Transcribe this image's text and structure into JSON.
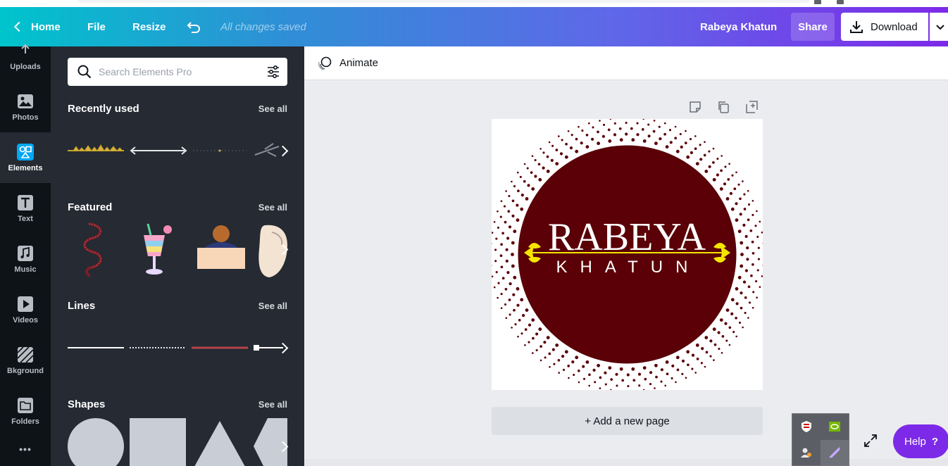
{
  "topbar": {
    "home": "Home",
    "file": "File",
    "resize": "Resize",
    "saved_status": "All changes saved",
    "user_name": "Rabeya Khatun",
    "share": "Share",
    "download": "Download"
  },
  "rail": {
    "uploads": "Uploads",
    "photos": "Photos",
    "elements": "Elements",
    "text": "Text",
    "music": "Music",
    "videos": "Videos",
    "background": "Bkground",
    "folders": "Folders",
    "more": "•••"
  },
  "panel": {
    "search_placeholder": "Search Elements Pro",
    "see_all": "See all",
    "sections": {
      "recent": "Recently used",
      "featured": "Featured",
      "lines": "Lines",
      "shapes": "Shapes"
    }
  },
  "editor": {
    "animate": "Animate",
    "add_page": "+ Add a new page",
    "help": "Help",
    "help_mark": "?"
  },
  "design": {
    "title": "RABEYA",
    "subtitle": "KHATUN",
    "circle_color": "#5a0006",
    "ornament_color": "#f5e600"
  },
  "colors": {
    "gradient_start": "#00c4cc",
    "gradient_end": "#7d2ae8",
    "panel_bg": "#252a33",
    "rail_bg": "#0e1318",
    "accent": "#7d2ae8"
  }
}
